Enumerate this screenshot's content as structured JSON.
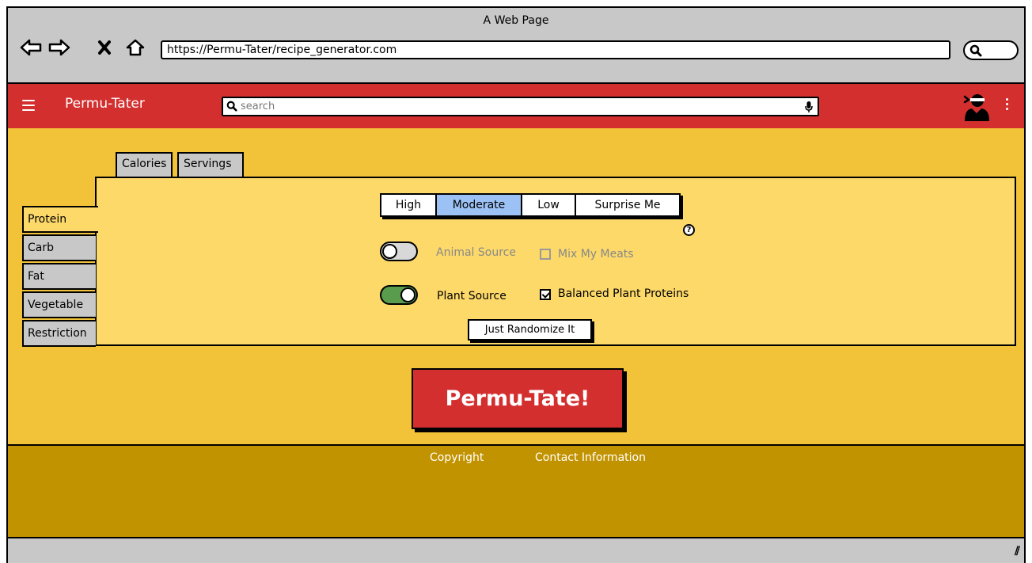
{
  "window": {
    "title": "A Web Page"
  },
  "browser": {
    "url": "https://Permu-Tater/recipe_generator.com",
    "icons": [
      "back-arrow-icon",
      "forward-arrow-icon",
      "close-x-icon",
      "home-icon",
      "search-icon"
    ]
  },
  "appbar": {
    "brand": "Permu-Tater",
    "search_placeholder": "search",
    "icons": [
      "hamburger-menu-icon",
      "search-icon",
      "microphone-icon",
      "user-avatar-icon",
      "kebab-menu-icon"
    ]
  },
  "top_tabs": [
    {
      "label": "Calories"
    },
    {
      "label": "Servings"
    }
  ],
  "side_tabs": [
    {
      "label": "Protein",
      "active": true
    },
    {
      "label": "Carb"
    },
    {
      "label": "Fat"
    },
    {
      "label": "Vegetable"
    },
    {
      "label": "Restriction"
    }
  ],
  "level_selector": {
    "options": [
      "High",
      "Moderate",
      "Low",
      "Surprise Me"
    ],
    "selected": "Moderate"
  },
  "help_icon": "help-question-icon",
  "options": {
    "animal_source": {
      "label": "Animal Source",
      "enabled": false,
      "checkbox_label": "Mix My Meats",
      "checked": false
    },
    "plant_source": {
      "label": "Plant Source",
      "enabled": true,
      "checkbox_label": "Balanced Plant Proteins",
      "checked": true
    }
  },
  "randomize_button": "Just Randomize It",
  "primary_button": "Permu-Tate!",
  "footer": {
    "copyright": "Copyright",
    "contact": "Contact Information"
  },
  "colors": {
    "appbar": "#d32f2f",
    "main_bg": "#f2c338",
    "panel_bg": "#fdd96a",
    "footer_bg": "#c29300",
    "selected_segment": "#9cc2f5",
    "toggle_on": "#5a9c4e"
  }
}
